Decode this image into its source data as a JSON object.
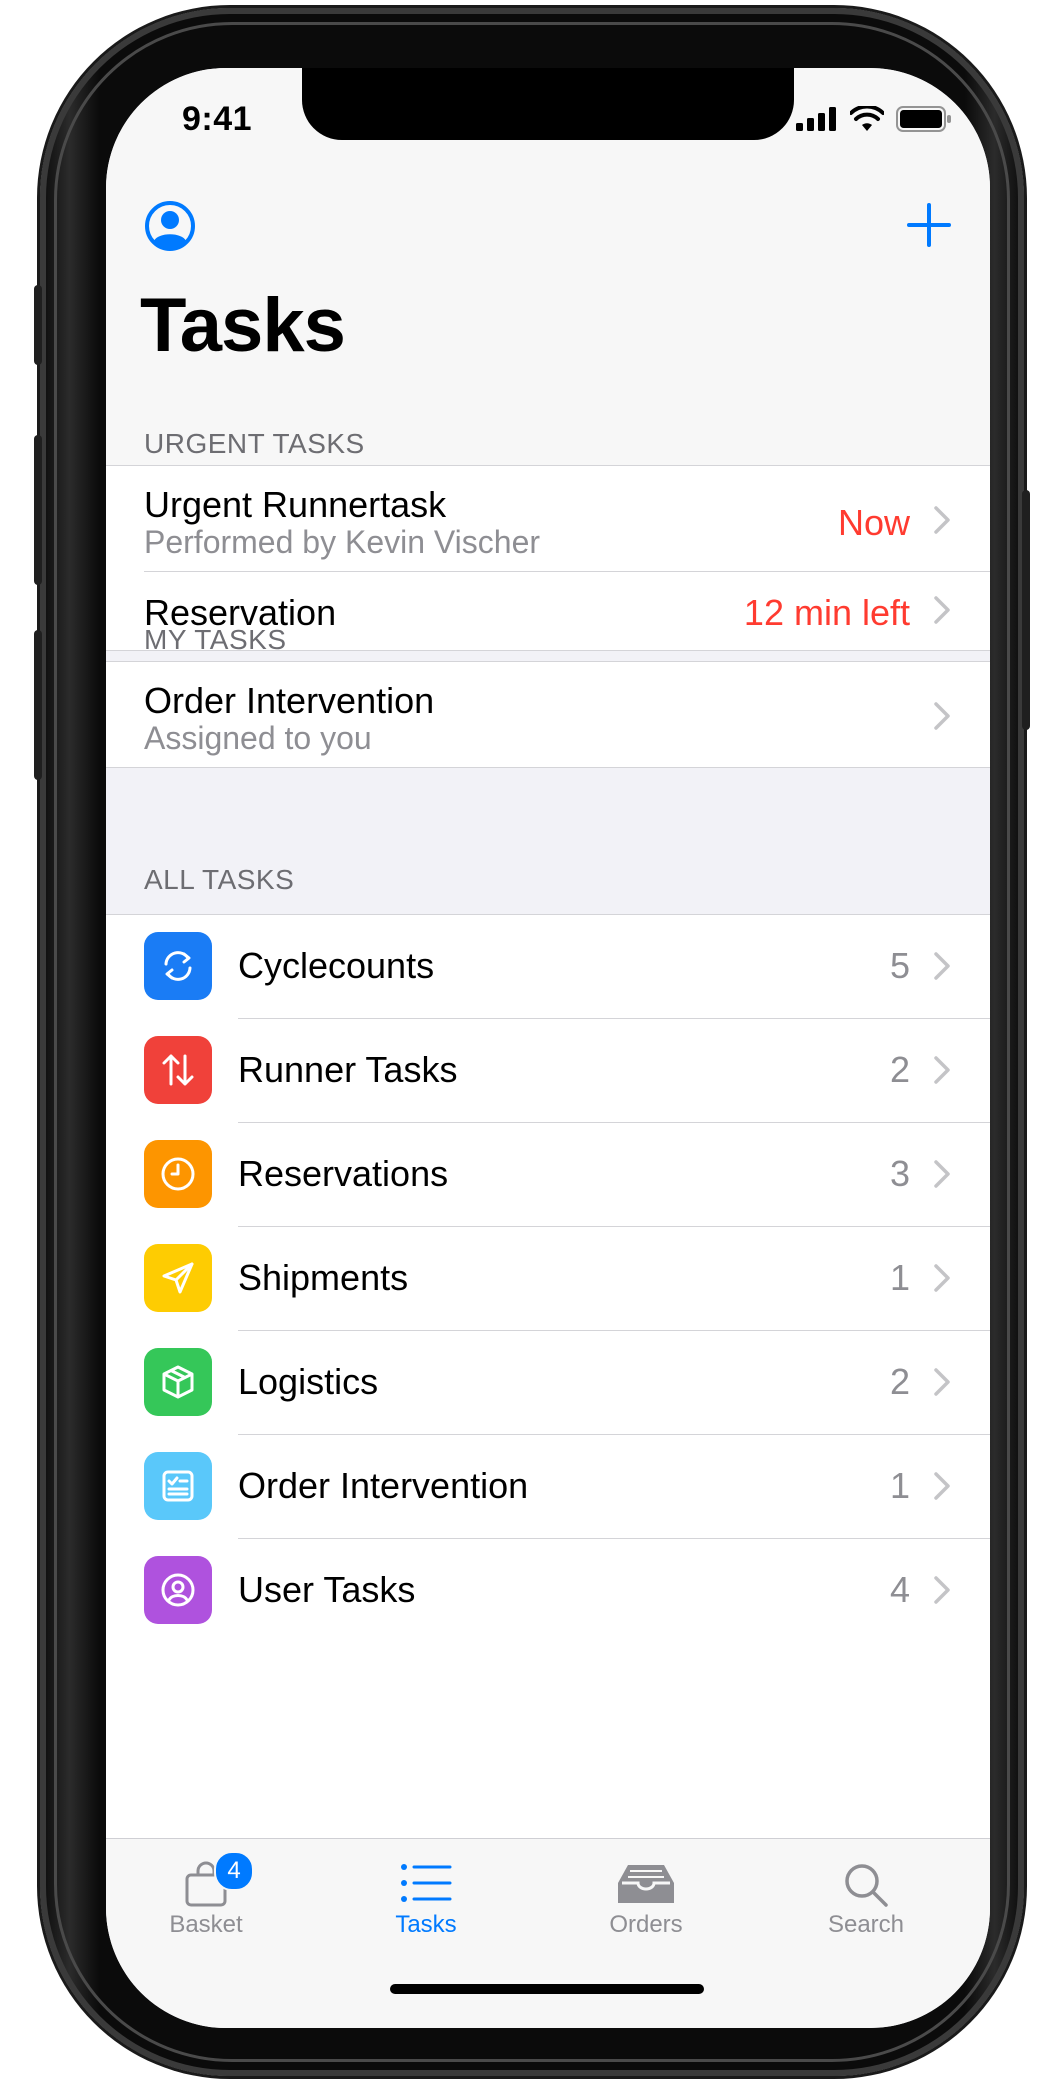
{
  "status_bar": {
    "time": "9:41"
  },
  "nav": {
    "title": "Tasks"
  },
  "sections": {
    "urgent": {
      "header": "URGENT TASKS"
    },
    "mine": {
      "header": "MY TASKS"
    },
    "all": {
      "header": "ALL TASKS"
    }
  },
  "urgent_tasks": [
    {
      "title": "Urgent Runnertask",
      "subtitle": "Performed by Kevin Vischer",
      "value": "Now"
    },
    {
      "title": "Reservation",
      "value": "12 min left"
    }
  ],
  "my_tasks": [
    {
      "title": "Order Intervention",
      "subtitle": "Assigned to you"
    }
  ],
  "all_tasks": [
    {
      "label": "Cyclecounts",
      "count": "5",
      "icon": "refresh-icon",
      "color": "#1a7cf5"
    },
    {
      "label": "Runner Tasks",
      "count": "2",
      "icon": "swap-arrows-icon",
      "color": "#f0413a"
    },
    {
      "label": "Reservations",
      "count": "3",
      "icon": "clock-icon",
      "color": "#fd9500"
    },
    {
      "label": "Shipments",
      "count": "1",
      "icon": "paper-plane-icon",
      "color": "#fecc02"
    },
    {
      "label": "Logistics",
      "count": "2",
      "icon": "box-icon",
      "color": "#35c759"
    },
    {
      "label": "Order Intervention",
      "count": "1",
      "icon": "checklist-icon",
      "color": "#5ac8fa"
    },
    {
      "label": "User Tasks",
      "count": "4",
      "icon": "user-circle-icon",
      "color": "#af52de"
    }
  ],
  "tab_bar": {
    "tabs": [
      {
        "label": "Basket",
        "icon": "bag-icon",
        "badge": "4"
      },
      {
        "label": "Tasks",
        "icon": "list-icon",
        "active": true
      },
      {
        "label": "Orders",
        "icon": "tray-icon"
      },
      {
        "label": "Search",
        "icon": "search-icon"
      }
    ]
  },
  "colors": {
    "accent": "#007aff",
    "urgent": "#ff3b30"
  }
}
